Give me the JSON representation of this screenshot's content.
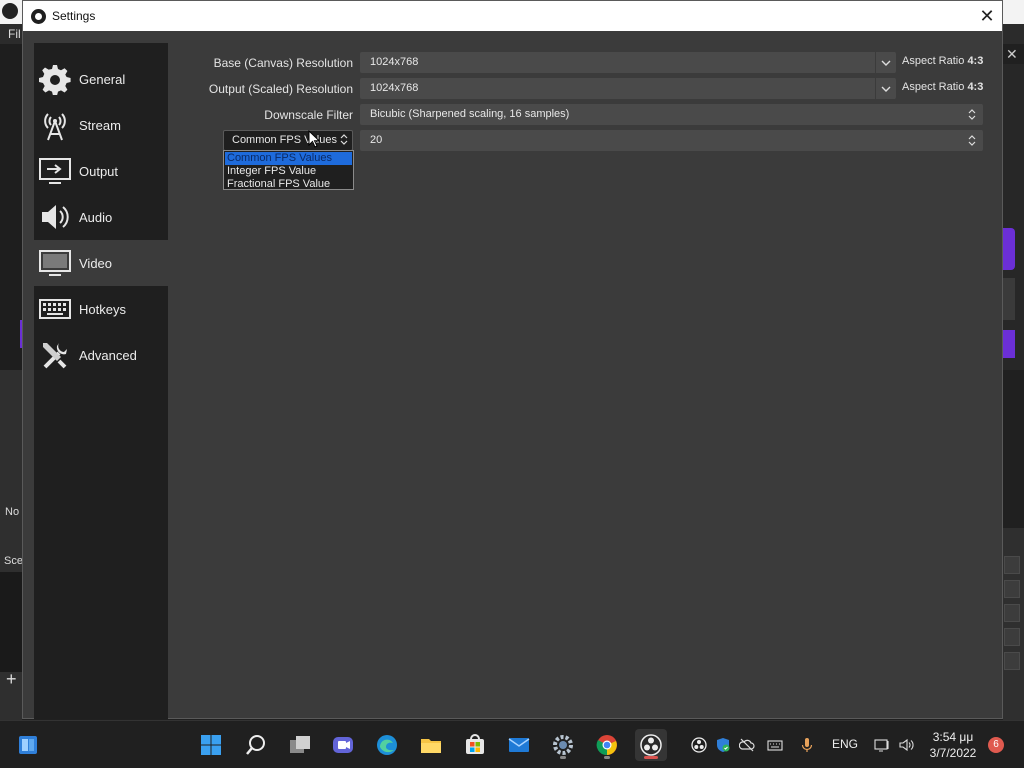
{
  "background_window": {
    "menu_file": "Fil",
    "close_glyph": "✕",
    "panel_no_label": "No",
    "panel_scene_label": "Sce",
    "add_glyph": "+"
  },
  "dialog": {
    "title": "Settings",
    "close_glyph": "✕"
  },
  "sidebar": {
    "items": [
      {
        "label": "General",
        "icon": "gear-icon"
      },
      {
        "label": "Stream",
        "icon": "antenna-icon"
      },
      {
        "label": "Output",
        "icon": "output-monitor-icon"
      },
      {
        "label": "Audio",
        "icon": "speaker-icon"
      },
      {
        "label": "Video",
        "icon": "monitor-icon",
        "active": true
      },
      {
        "label": "Hotkeys",
        "icon": "keyboard-icon"
      },
      {
        "label": "Advanced",
        "icon": "tools-icon"
      }
    ]
  },
  "video": {
    "base_resolution": {
      "label": "Base (Canvas) Resolution",
      "value": "1024x768",
      "aspect_label": "Aspect Ratio",
      "aspect_value": "4:3"
    },
    "output_resolution": {
      "label": "Output (Scaled) Resolution",
      "value": "1024x768",
      "aspect_label": "Aspect Ratio",
      "aspect_value": "4:3"
    },
    "downscale_filter": {
      "label": "Downscale Filter",
      "value": "Bicubic (Sharpened scaling, 16 samples)"
    },
    "fps": {
      "mode_value": "Common FPS Values",
      "value": "20",
      "options": [
        "Common FPS Values",
        "Integer FPS Value",
        "Fractional FPS Value"
      ],
      "selected_index": 0
    }
  },
  "taskbar": {
    "apps": [
      "widgets-icon",
      "start-icon",
      "search-icon",
      "task-view-icon",
      "chat-icon",
      "edge-icon",
      "file-explorer-icon",
      "store-icon",
      "mail-icon",
      "settings-icon",
      "chrome-icon",
      "obs-icon"
    ],
    "language": "ENG",
    "time": "3:54 μμ",
    "date": "3/7/2022",
    "notification_count": "6"
  },
  "colors": {
    "selection": "#1e6bdc",
    "accent_purple": "#6b2fd6",
    "badge": "#e05a4f"
  }
}
